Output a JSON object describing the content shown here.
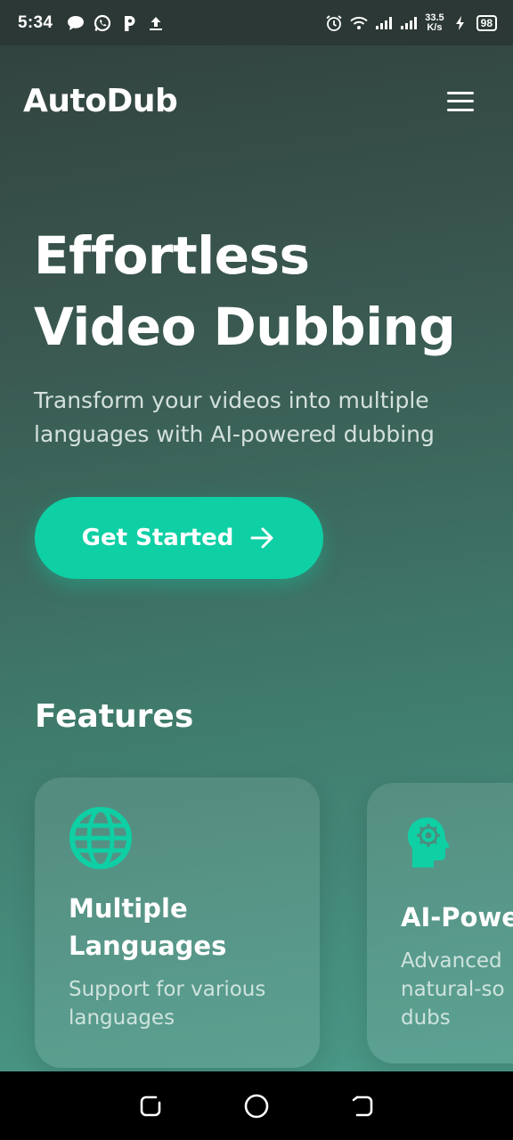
{
  "status_bar": {
    "time": "5:34",
    "net_speed_value": "33.5",
    "net_speed_unit": "K/s",
    "battery": "98"
  },
  "app": {
    "logo": "AutoDub"
  },
  "hero": {
    "title": "Effortless Video Dubbing",
    "subtitle": "Transform your videos into multiple languages with AI-powered dubbing",
    "cta_label": "Get Started"
  },
  "features": {
    "title": "Features",
    "cards": [
      {
        "icon": "globe-icon",
        "title": "Multiple Languages",
        "description": "Support for various languages"
      },
      {
        "icon": "ai-head-icon",
        "title": "AI-Powe",
        "description_lines": [
          "Advanced",
          "natural-so",
          "dubs"
        ]
      }
    ]
  },
  "colors": {
    "accent": "#0fcfa5",
    "bg_top": "#32433f",
    "bg_bottom": "#4a9988"
  }
}
